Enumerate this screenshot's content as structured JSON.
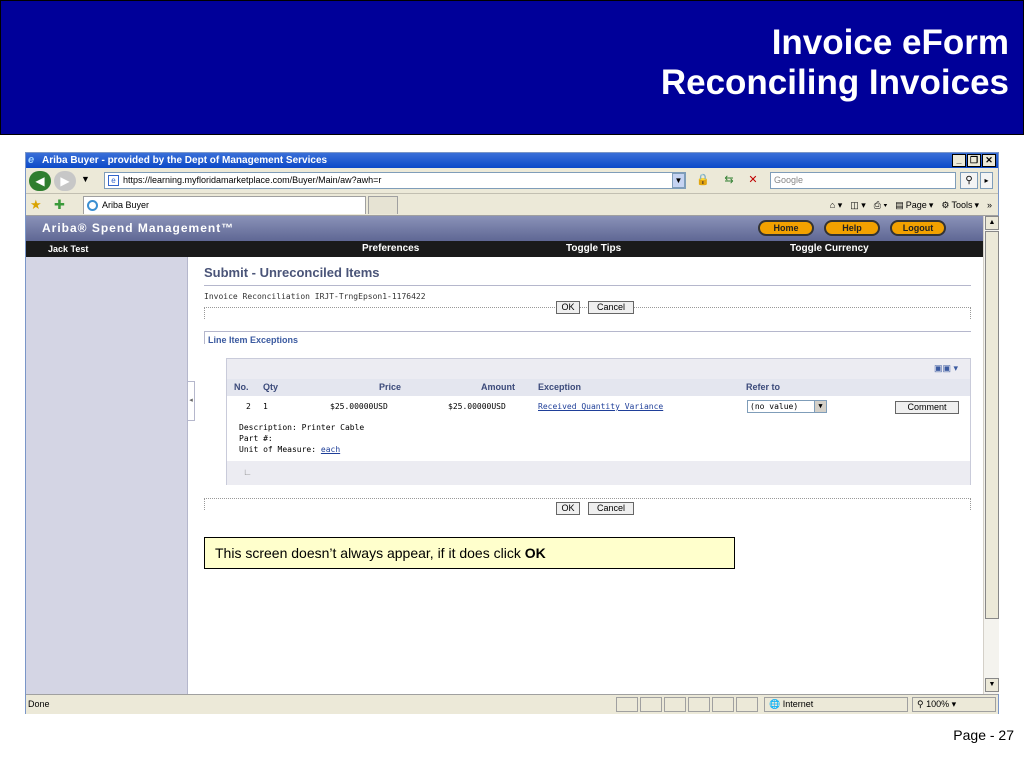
{
  "slide": {
    "title_line1": "Invoice eForm",
    "title_line2": "Reconciling Invoices",
    "page_number": "Page - 27",
    "callout_text": "This screen doesn’t always appear, if it does click ",
    "callout_bold": "OK"
  },
  "browser": {
    "window_title": "Ariba Buyer - provided by the Dept of Management Services",
    "url": "https://learning.myfloridamarketplace.com/Buyer/Main/aw?awh=r",
    "search_placeholder": "Google",
    "tab_label": "Ariba Buyer",
    "cmd_page": "Page",
    "cmd_tools": "Tools",
    "status_text": "Done",
    "status_zone": "Internet",
    "zoom": "100%"
  },
  "ariba": {
    "logo": "Ariba® Spend Management™",
    "buttons": [
      "Home",
      "Help",
      "Logout"
    ],
    "user": "Jack Test",
    "nav": [
      "Preferences",
      "Toggle Tips",
      "Toggle Currency"
    ]
  },
  "page": {
    "title": "Submit - Unreconciled Items",
    "subtitle": "Invoice Reconciliation IRJT-TrngEpson1-1176422",
    "ok_label": "OK",
    "cancel_label": "Cancel",
    "section_label": "Line Item Exceptions"
  },
  "exceptions": {
    "columns": [
      "No.",
      "Qty",
      "Price",
      "Amount",
      "Exception",
      "Refer to"
    ],
    "row": {
      "no": "2",
      "qty": "1",
      "price": "$25.00000USD",
      "amount": "$25.00000USD",
      "exception": "Received Quantity Variance",
      "refer_to": "(no value)",
      "comment_label": "Comment"
    },
    "description_label": "Description:",
    "description_value": "Printer Cable",
    "part_label": "Part #:",
    "uom_label": "Unit of Measure:",
    "uom_value": "each"
  },
  "colors": {
    "slide_header": "#000099",
    "ariba_orange": "#f2a100",
    "callout_bg": "#ffffcc"
  }
}
